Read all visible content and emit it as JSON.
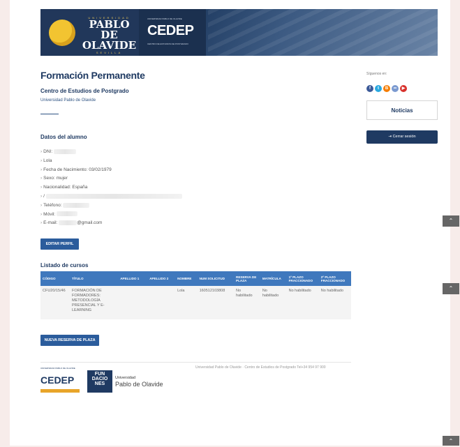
{
  "header": {
    "upo_small_top": "UNIVERSIDAD",
    "upo_name_1": "PABLO DE",
    "upo_name_2": "OLAVIDE",
    "upo_small_bottom": "SEVILLA",
    "cedep_top": "UNIVERSIDAD PABLO DE OLAVIDE",
    "cedep_logo": "CEDEP",
    "cedep_sub": "CENTRO DE ESTUDIOS DE POSTGRADO"
  },
  "page": {
    "title": "Formación Permanente",
    "subtitle": "Centro de Estudios de Postgrado",
    "university": "Universidad Pablo de Olavide"
  },
  "student": {
    "section_title": "Datos del alumno",
    "fields": [
      {
        "label": "DNI:",
        "value": ""
      },
      {
        "label": "Lola",
        "value": ""
      },
      {
        "label": "Fecha de Nacimiento: 03/02/1979",
        "value": ""
      },
      {
        "label": "Sexo: mujer",
        "value": ""
      },
      {
        "label": "Nacionalidad: España",
        "value": ""
      },
      {
        "label": "/",
        "value": ""
      },
      {
        "label": "Teléfono:",
        "value": ""
      },
      {
        "label": "Móvil:",
        "value": ""
      },
      {
        "label": "E-mail:",
        "value": "@gmail.com"
      }
    ],
    "edit_button": "EDITAR PERFIL"
  },
  "courses": {
    "section_title": "Listado de cursos",
    "columns": [
      "CÓDIGO",
      "TÍTULO",
      "APELLIDO 1",
      "APELLIDO 2",
      "NOMBRE",
      "NUM SOLICITUD",
      "RESERVA DE PLAZA",
      "MATRÍCULA",
      "1º PLAZO FRACCIONADO",
      "2º PLAZO FRACCIONADO"
    ],
    "rows": [
      [
        "CFU20/15/46",
        "FORMACIÓN DE FORMADORES: METODOLOGÍA PRESENCIAL Y E-LEARNING",
        "",
        "",
        "Lola",
        "160512103808",
        "No habilitado",
        "No habilitado",
        "No habilitado",
        "No habilitado"
      ]
    ],
    "new_button": "NUEVA RESERVA DE PLAZA"
  },
  "footer": {
    "text": "Universidad Pablo de Olavide · Centro de Estudios de Postgrado Tel+34 954 97 900",
    "cedep_small": "UNIVERSIDAD PABLO DE OLAVIDE",
    "cedep_logo": "CEDEP",
    "fundacion": "FUN DACIO NES",
    "upo_line1": "Universidad",
    "upo_line2": "Pablo de Olavide"
  },
  "sidebar": {
    "follow": "Síguenos en:",
    "social_icons": [
      "facebook-icon",
      "twitter-icon",
      "blogger-icon",
      "flickr-icon",
      "youtube-icon"
    ],
    "noticias": "Noticias",
    "logout": "Cerrar sesión"
  },
  "colors": {
    "primary": "#1f3a62",
    "button": "#2b5c9c",
    "table_header": "#3f78bd",
    "accent": "#e8a52a"
  }
}
